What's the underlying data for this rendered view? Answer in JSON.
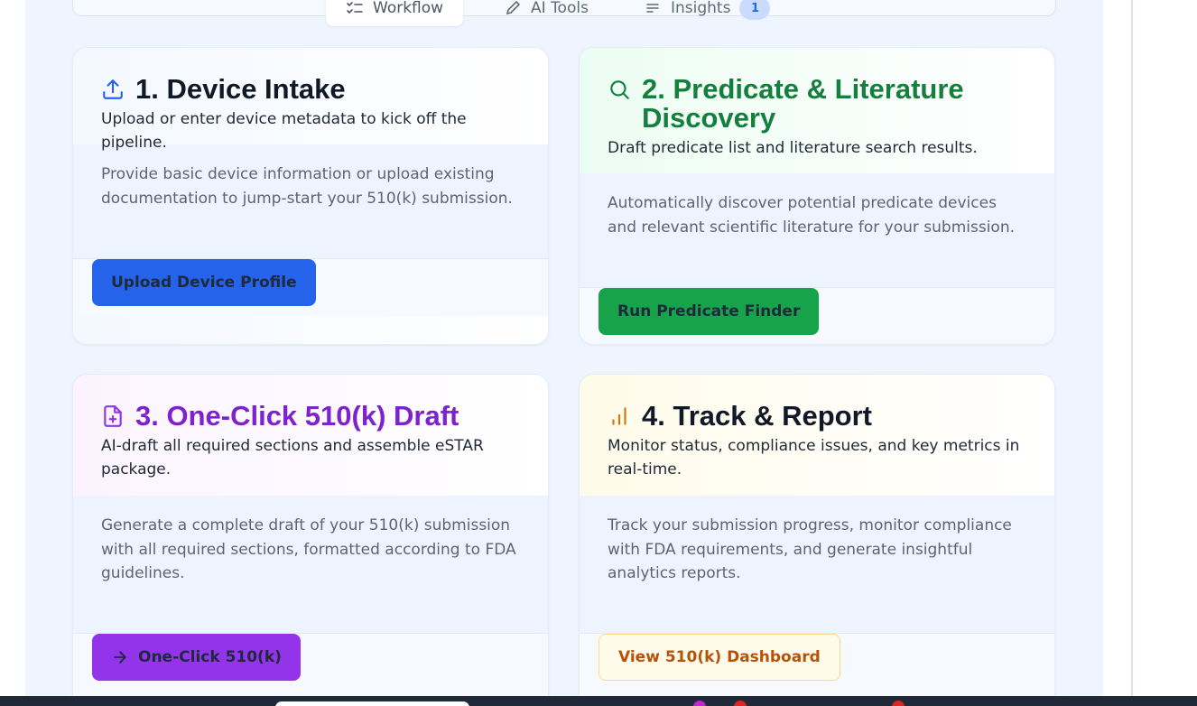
{
  "tabs": [
    {
      "label": "Workflow",
      "icon": "list-check-icon",
      "active": true
    },
    {
      "label": "AI Tools",
      "icon": "pen-icon",
      "active": false
    },
    {
      "label": "Insights",
      "icon": "list-icon",
      "active": false,
      "badge": "1"
    }
  ],
  "cards": [
    {
      "title": "1. Device Intake",
      "subtitle": "Upload or enter device metadata to kick off the pipeline.",
      "description": "Provide basic device information or upload existing documentation to jump-start your 510(k) submission.",
      "button": "Upload Device Profile",
      "icon": "upload-icon",
      "accent": "#2563eb"
    },
    {
      "title": "2. Predicate & Literature Discovery",
      "subtitle": "Draft predicate list and literature search results.",
      "description": "Automatically discover potential predicate devices and relevant scientific literature for your submission.",
      "button": "Run Predicate Finder",
      "icon": "search-icon",
      "accent": "#15803d"
    },
    {
      "title": "3. One-Click 510(k) Draft",
      "subtitle": "AI-draft all required sections and assemble eSTAR package.",
      "description": "Generate a complete draft of your 510(k) submission with all required sections, formatted according to FDA guidelines.",
      "button": "One-Click 510(k)",
      "icon": "file-plus-icon",
      "button_icon": "arrow-right-icon",
      "accent": "#9333ea"
    },
    {
      "title": "4. Track & Report",
      "subtitle": "Monitor status, compliance issues, and key metrics in real-time.",
      "description": "Track your submission progress, monitor compliance with FDA requirements, and generate insightful analytics reports.",
      "button": "View 510(k) Dashboard",
      "icon": "bar-chart-icon",
      "accent": "#d97706"
    }
  ]
}
